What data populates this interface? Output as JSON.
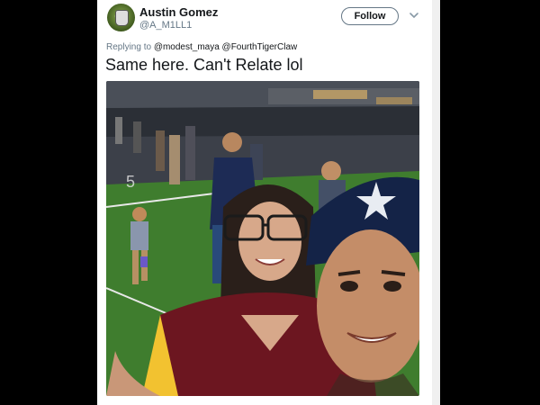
{
  "tweet": {
    "display_name": "Austin Gomez",
    "handle": "@A_M1LL1",
    "follow_label": "Follow",
    "replying_prefix": "Replying to",
    "replying_mentions": "@modest_maya @FourthTigerClaw",
    "text": "Same here. Can't Relate lol"
  },
  "icons": {
    "avatar": "profile-avatar",
    "more": "chevron-down-icon"
  },
  "colors": {
    "background": "#000000",
    "card": "#ffffff",
    "text": "#14171a",
    "secondary": "#657786"
  }
}
